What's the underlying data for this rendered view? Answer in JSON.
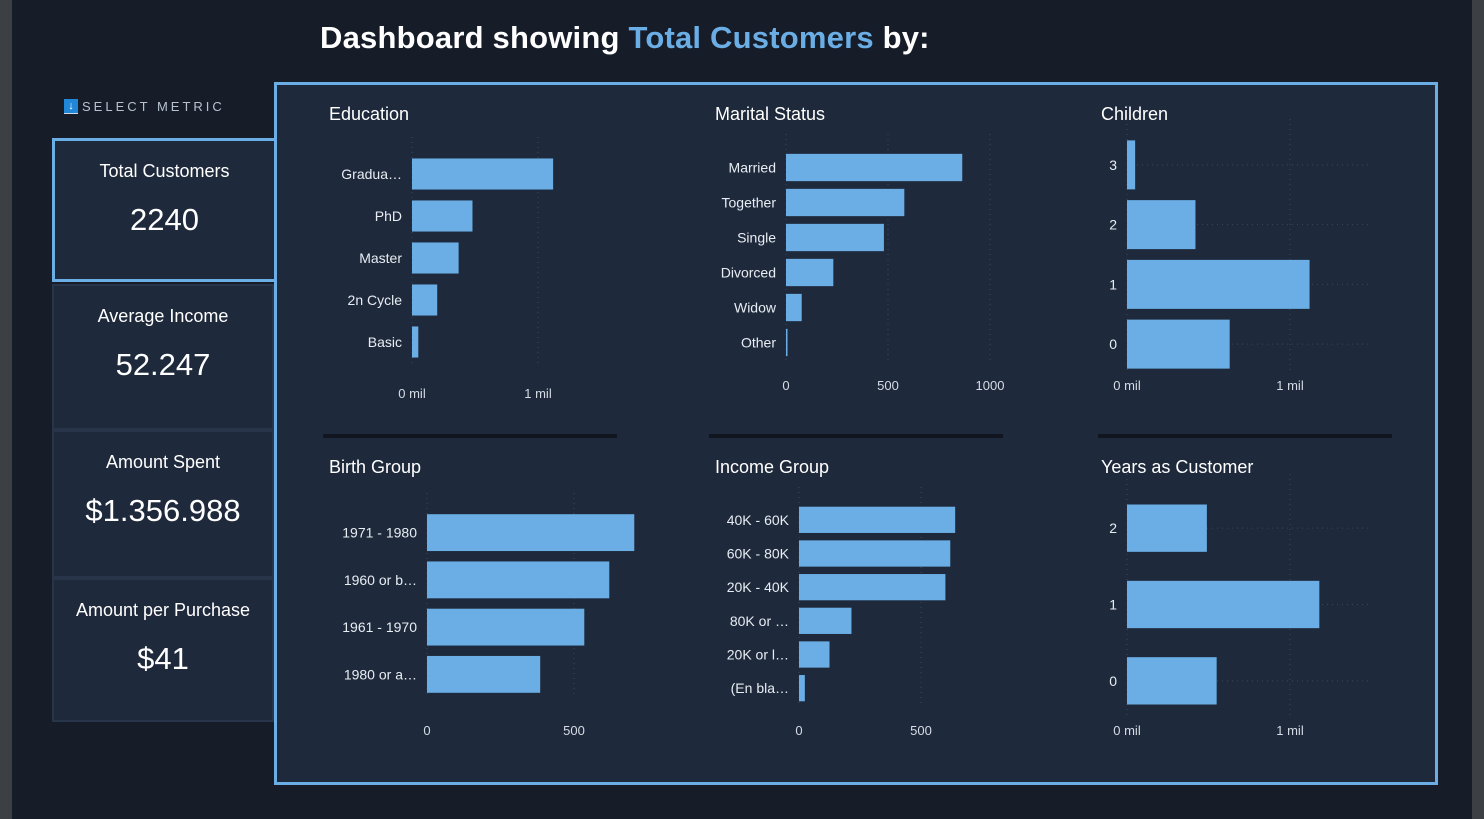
{
  "header": {
    "prefix": "Dashboard showing",
    "metric": "Total Customers",
    "suffix": "by:"
  },
  "sidebar": {
    "select_label": "SELECT METRIC",
    "metrics": [
      {
        "label": "Total Customers",
        "value": "2240",
        "active": true
      },
      {
        "label": "Average Income",
        "value": "52.247",
        "active": false
      },
      {
        "label": "Amount Spent",
        "value": "$1.356.988",
        "active": false
      },
      {
        "label": "Amount per Purchase",
        "value": "$41",
        "active": false
      }
    ]
  },
  "colors": {
    "bar": "#6aaee5",
    "accent": "#6aaee5",
    "background": "#1e293b",
    "page": "#161d29"
  },
  "chart_data": [
    {
      "type": "bar",
      "orientation": "horizontal",
      "title": "Education",
      "categories": [
        "Gradua…",
        "PhD",
        "Master",
        "2n Cycle",
        "Basic"
      ],
      "values": [
        1.12,
        0.48,
        0.37,
        0.2,
        0.05
      ],
      "xticks": [
        "0 mil",
        "1 mil"
      ],
      "xtick_values": [
        0,
        1
      ],
      "xlim": [
        0,
        1.3
      ]
    },
    {
      "type": "bar",
      "orientation": "horizontal",
      "title": "Marital Status",
      "categories": [
        "Married",
        "Together",
        "Single",
        "Divorced",
        "Widow",
        "Other"
      ],
      "values": [
        864,
        580,
        480,
        232,
        77,
        7
      ],
      "xticks": [
        "0",
        "500",
        "1000"
      ],
      "xtick_values": [
        0,
        500,
        1000
      ],
      "xlim": [
        0,
        1080
      ]
    },
    {
      "type": "bar",
      "orientation": "horizontal",
      "title": "Children",
      "categories": [
        "3",
        "2",
        "1",
        "0"
      ],
      "values": [
        0.05,
        0.42,
        1.12,
        0.63
      ],
      "xticks": [
        "0 mil",
        "1 mil"
      ],
      "xtick_values": [
        0,
        1
      ],
      "xlim": [
        0,
        1.5
      ]
    },
    {
      "type": "bar",
      "orientation": "horizontal",
      "title": "Birth Group",
      "categories": [
        "1971 - 1980",
        "1960 or b…",
        "1961 - 1970",
        "1980 or a…"
      ],
      "values": [
        705,
        620,
        535,
        385
      ],
      "xticks": [
        "0",
        "500"
      ],
      "xtick_values": [
        0,
        500
      ],
      "xlim": [
        0,
        740
      ]
    },
    {
      "type": "bar",
      "orientation": "horizontal",
      "title": "Income Group",
      "categories": [
        "40K - 60K",
        "60K - 80K",
        "20K - 40K",
        "80K or …",
        "20K or l…",
        "(En bla…"
      ],
      "values": [
        640,
        620,
        600,
        215,
        125,
        24
      ],
      "xticks": [
        "0",
        "500"
      ],
      "xtick_values": [
        0,
        500
      ],
      "xlim": [
        0,
        680
      ]
    },
    {
      "type": "bar",
      "orientation": "horizontal",
      "title": "Years as Customer",
      "categories": [
        "2",
        "1",
        "0"
      ],
      "values": [
        0.49,
        1.18,
        0.55
      ],
      "xticks": [
        "0 mil",
        "1 mil"
      ],
      "xtick_values": [
        0,
        1
      ],
      "xlim": [
        0,
        1.5
      ]
    }
  ]
}
